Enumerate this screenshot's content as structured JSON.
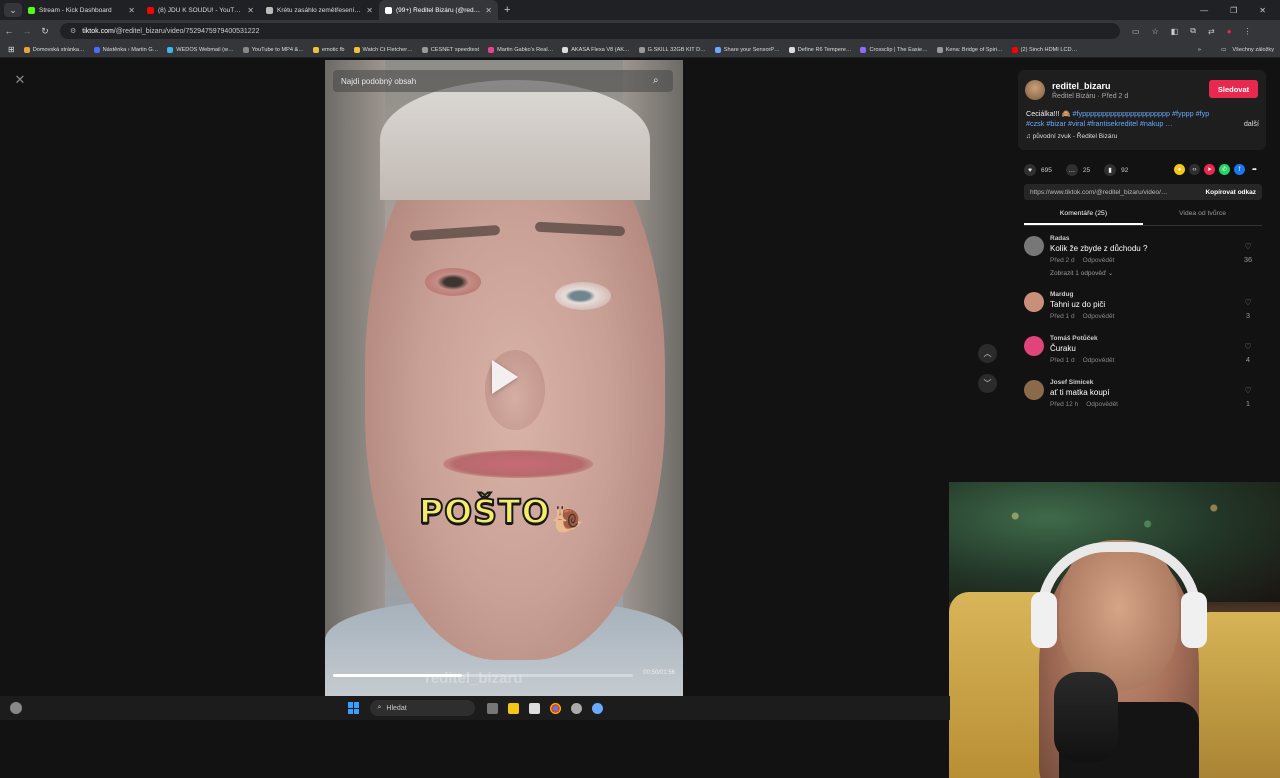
{
  "browser": {
    "tabs": [
      {
        "title": "Stream - Kick Dashboard",
        "color": "#53fc18",
        "active": false
      },
      {
        "title": "(8) JDU K SOUDU! - YouTube",
        "color": "#ff0000",
        "active": false
      },
      {
        "title": "Krétu zasáhlo zemětřesení, škod…",
        "color": "#bbbbbb",
        "active": false
      },
      {
        "title": "(99+) Ředitel Bizáru (@reditel_b…",
        "color": "#ffffff",
        "active": true
      }
    ],
    "url_domain": "tiktok.com",
    "url_path": "/@reditel_bizaru/video/7529475979400531222",
    "bookmarks": [
      {
        "label": "Domovská stránka…",
        "color": "#e8a33d"
      },
      {
        "label": "Nástěnka › Martin G…",
        "color": "#4a6cf7"
      },
      {
        "label": "WEDOS Webmail (w…",
        "color": "#3db7e8"
      },
      {
        "label": "YouTube to MP4 &…",
        "color": "#888888"
      },
      {
        "label": "emotic fb",
        "color": "#f0c040"
      },
      {
        "label": "Watch Ct Fletcher…",
        "color": "#f0c040"
      },
      {
        "label": "CESNET speedtest",
        "color": "#999999"
      },
      {
        "label": "Martin Gabko's Real…",
        "color": "#e84393"
      },
      {
        "label": "AKASA Flexa V8 (AK…",
        "color": "#dddddd"
      },
      {
        "label": "G.SKILL 32GB KIT D…",
        "color": "#999999"
      },
      {
        "label": "Share your SensorP…",
        "color": "#6aa9ff"
      },
      {
        "label": "Define R6 Tempere…",
        "color": "#dddddd"
      },
      {
        "label": "Crossclip | The Easie…",
        "color": "#8e6cf7"
      },
      {
        "label": "Kena: Bridge of Spiri…",
        "color": "#999999"
      },
      {
        "label": "(2) Sinch HDMI LCD…",
        "color": "#ff0000"
      }
    ],
    "bookmarks_more": "»",
    "all_bookmarks": "Všechny záložky"
  },
  "video": {
    "search_placeholder": "Najdi podobný obsah",
    "caption": "POŠTO",
    "caption_emoji": "🐌",
    "watermark": "reditel_bizaru",
    "time": "00:50/01:56",
    "progress": 0.43
  },
  "author": {
    "username": "reditel_bizaru",
    "subtitle": "Ředitel Bizáru · Před 2 d",
    "follow_label": "Sledovat",
    "desc_text": "Ceciálka!!! 🙈",
    "desc_tags1": "#fypppppppppppppppppppppp #fyppp #fyp",
    "desc_tags2": "#czsk #bizar #viral #frantisekreditel #nakup …",
    "more_label": "další",
    "sound": "♫  původní zvuk - Ředitel Bizáru"
  },
  "stats": {
    "likes": "695",
    "comments": "25",
    "saves": "92"
  },
  "link": {
    "url": "https://www.tiktok.com/@reditel_bizaru/video/…",
    "copy_label": "Kopírovat odkaz"
  },
  "tabs": {
    "comments": "Komentáře (25)",
    "creator": "Videa od tvůrce"
  },
  "comments": [
    {
      "name": "Radas",
      "text": "Kolik že zbyde z důchodu ?",
      "time": "Před 2 d",
      "reply": "Odpovědět",
      "likes": "36",
      "replies": "Zobrazit 1 odpověď ⌄",
      "color": "#777777"
    },
    {
      "name": "Mardug",
      "text": "Tahni uz do piči",
      "time": "Před 1 d",
      "reply": "Odpovědět",
      "likes": "3",
      "replies": "",
      "color": "#c98f7a"
    },
    {
      "name": "Tomáš Potůček",
      "text": "Čuraku",
      "time": "Před 1 d",
      "reply": "Odpovědět",
      "likes": "4",
      "replies": "",
      "color": "#e0447a"
    },
    {
      "name": "Josef Simicek",
      "text": "ať ti matka koupí",
      "time": "Před 12 h",
      "reply": "Odpovědět",
      "likes": "1",
      "replies": "",
      "color": "#8a6a4a"
    }
  ],
  "taskbar": {
    "search_label": "Hledat"
  }
}
